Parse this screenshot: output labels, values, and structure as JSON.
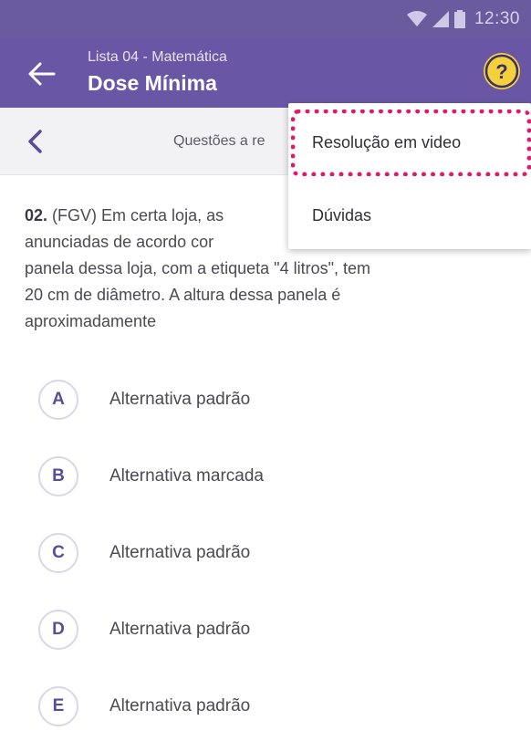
{
  "status_bar": {
    "time": "12:30",
    "icons": [
      "wifi-icon",
      "signal-icon",
      "battery-icon"
    ]
  },
  "app_bar": {
    "subtitle": "Lista 04 - Matemática",
    "title": "Dose Mínima",
    "help_symbol": "?"
  },
  "nav_bar": {
    "label": "Questões a re"
  },
  "question": {
    "number": "02.",
    "line1_before": "(FGV) Em certa loja, as",
    "line2_before": "anunciadas de acordo cor",
    "line3": "panela dessa loja, com a etiqueta \"4 litros\", tem",
    "line4": "20 cm de diâmetro. A altura dessa panela é",
    "line5": "aproximadamente"
  },
  "alternatives": [
    {
      "letter": "A",
      "text": "Alternativa padrão"
    },
    {
      "letter": "B",
      "text": "Alternativa marcada"
    },
    {
      "letter": "C",
      "text": "Alternativa padrão"
    },
    {
      "letter": "D",
      "text": "Alternativa padrão"
    },
    {
      "letter": "E",
      "text": "Alternativa padrão"
    }
  ],
  "menu": {
    "items": [
      "Resolução em video",
      "Dúvidas"
    ],
    "highlighted": "Resolução em video"
  },
  "colors": {
    "primary": "#6957a6",
    "status_bar": "#6a5b9f",
    "help_button": "#f4d13a",
    "highlight": "#e0196e",
    "accent_text": "#5b4b9b"
  }
}
